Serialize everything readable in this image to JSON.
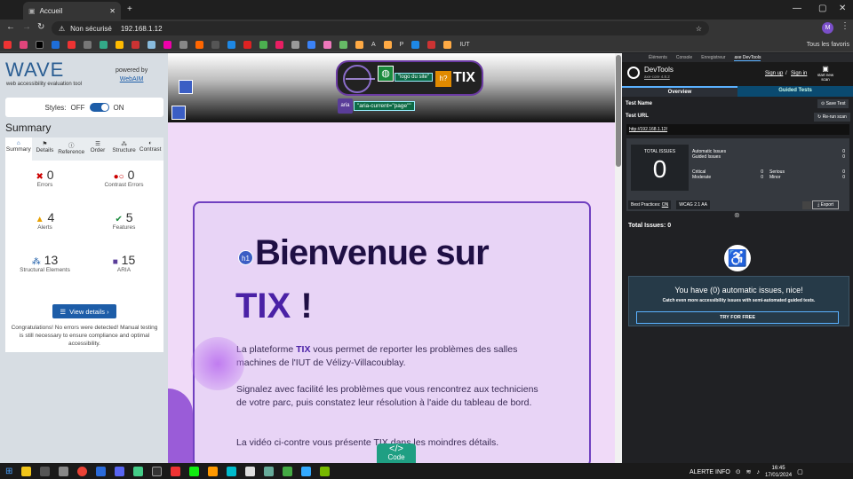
{
  "browser": {
    "tab_title": "Accueil",
    "security": "Non sécurisé",
    "url": "192.168.1.12",
    "all_bookmarks": "Tous les favoris",
    "bookmark_a": "A",
    "bookmark_p": "P",
    "bookmark_iut": "IUT"
  },
  "wave": {
    "logo": "WAVE",
    "subtitle": "web accessibility evaluation tool",
    "powered": "powered by",
    "webaim": "WebAIM",
    "styles_label": "Styles:",
    "off": "OFF",
    "on": "ON",
    "summary_title": "Summary",
    "tabs": [
      "Summary",
      "Details",
      "Reference",
      "Order",
      "Structure",
      "Contrast"
    ],
    "stats": {
      "errors": {
        "n": "0",
        "label": "Errors"
      },
      "contrast": {
        "n": "0",
        "label": "Contrast Errors"
      },
      "alerts": {
        "n": "4",
        "label": "Alerts"
      },
      "features": {
        "n": "5",
        "label": "Features"
      },
      "structural": {
        "n": "13",
        "label": "Structural Elements"
      },
      "aria": {
        "n": "15",
        "label": "ARIA"
      }
    },
    "view_details": "View details ›",
    "congrats": "Congratulations! No errors were detected! Manual testing is still necessary to ensure compliance and optimal accessibility."
  },
  "page": {
    "logo_label": "\"logo du site\"",
    "tix_logo": "TIX",
    "aria_badge": "aria",
    "aria_current": "\"aria-current=\"page\"\"",
    "h1_badge": "h1",
    "h1_line1": "Bienvenue sur",
    "h1_tix": "TIX",
    "h1_bang": " !",
    "p1_pre": "La plateforme ",
    "p1_tix": "TIX",
    "p1_post": " vous permet de reporter les problèmes des salles machines de l'IUT de Vélizy-Villacoublay.",
    "p2": "Signalez avec facilité les problèmes que vous rencontrez aux techniciens de votre parc, puis constatez leur résolution à l'aide du tableau de bord.",
    "p3": "La vidéo ci-contre vous présente TIX dans les moindres détails.",
    "code_label": "Code",
    "code_glyph": "</>"
  },
  "devtools": {
    "tabs": [
      "Éléments",
      "Console",
      "Enregistreur",
      "axe DevTools"
    ],
    "title": "DevTools",
    "version": "axe-core 4.8.2",
    "sign_up": "Sign up",
    "sign_in": "Sign in",
    "slash": "/",
    "start_scan": "start new scan",
    "overview": "Overview",
    "guided": "Guided Tests",
    "test_name": "Test Name",
    "save_test": "Save Test",
    "test_url": "Test URL",
    "rerun": "Re-run scan",
    "url": "http://192.168.1.12/",
    "total_issues_label": "TOTAL ISSUES",
    "total": "0",
    "rows": [
      [
        "Automatic Issues",
        "0"
      ],
      [
        "Guided Issues",
        "0"
      ]
    ],
    "crit": [
      [
        "Critical",
        "0",
        "Serious",
        "0"
      ],
      [
        "Moderate",
        "0",
        "Minor",
        "0"
      ]
    ],
    "best": "Best Practices:",
    "best_val": "ON",
    "wcag": "WCAG 2.1 AA",
    "export": "Export",
    "total_line": "Total Issues: 0",
    "nice": "You have (0) automatic issues, nice!",
    "catch": "Catch even more accessibility issues with semi-automated guided tests.",
    "try": "TRY FOR FREE"
  },
  "taskbar": {
    "alert": "ALERTE INFO",
    "time": "16:45",
    "date": "17/01/2024"
  }
}
